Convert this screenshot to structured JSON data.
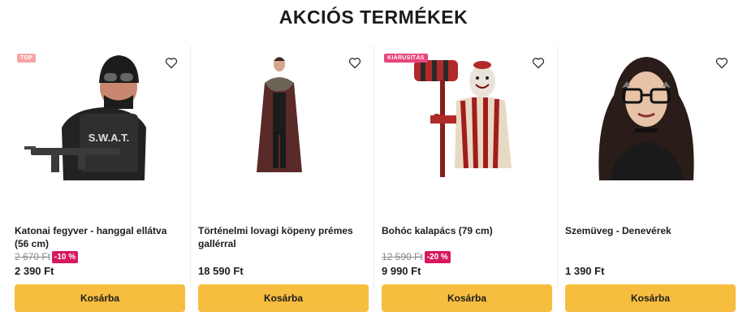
{
  "section": {
    "title": "AKCIÓS TERMÉKEK"
  },
  "products": [
    {
      "name": "Katonai fegyver - hanggal ellátva (56 cm)",
      "badge": "TOP",
      "badge_color": "#f7a5a5",
      "old_price": "2 670 Ft",
      "discount": "-10 %",
      "price": "2 390 Ft",
      "button": "Kosárba",
      "image_icon": "swat-costume-image"
    },
    {
      "name": "Történelmi lovagi köpeny prémes gallérral",
      "badge": "",
      "old_price": "",
      "discount": "",
      "price": "18 590 Ft",
      "button": "Kosárba",
      "image_icon": "knight-cape-image"
    },
    {
      "name": "Bohóc kalapács (79 cm)",
      "badge": "KIÁRUSÍTÁS",
      "badge_color": "#e8457d",
      "old_price": "12 590 Ft",
      "discount": "-20 %",
      "price": "9 990 Ft",
      "button": "Kosárba",
      "image_icon": "clown-hammer-image"
    },
    {
      "name": "Szemüveg - Denevérek",
      "badge": "",
      "old_price": "",
      "discount": "",
      "price": "1 390 Ft",
      "button": "Kosárba",
      "image_icon": "bat-glasses-image"
    }
  ],
  "colors": {
    "button": "#f6bd3f",
    "discount": "#d6185f",
    "sale_badge": "#e8457d"
  }
}
